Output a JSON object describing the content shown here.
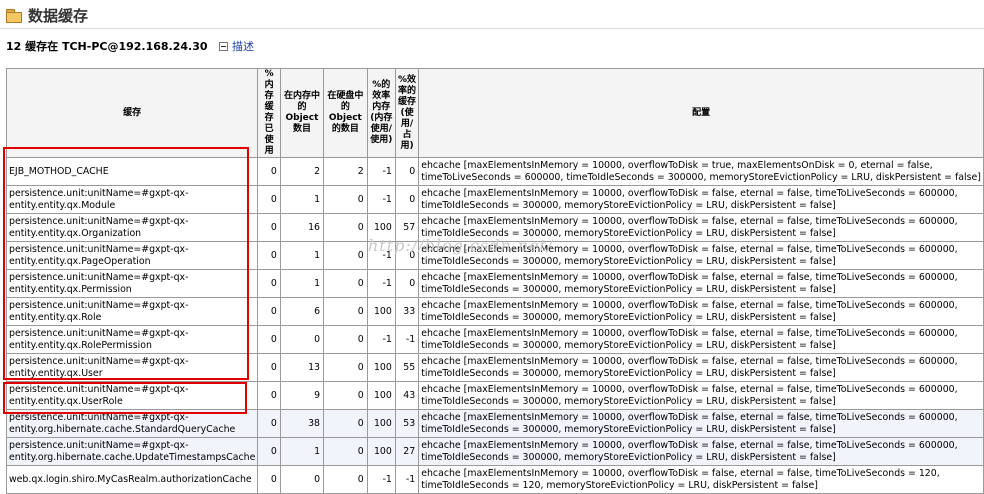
{
  "page": {
    "title": "数据缓存",
    "host_line": "12 缓存在 TCH-PC@192.168.24.30",
    "describe_link": "描述",
    "watermark": "http://blog.csdn.net/"
  },
  "table": {
    "headers": [
      "缓存",
      "%内存缓存已使用",
      "在内存中的Object数目",
      "在硬盘中的Object的数目",
      "%的效率内存(内存使用/使用)",
      "%效率的缓存(使用/占用)",
      "配置"
    ],
    "rows": [
      {
        "name": "EJB_MOTHOD_CACHE",
        "mem_used": "0",
        "in_mem": "2",
        "on_disk": "2",
        "mem_eff": "-1",
        "cache_eff": "0",
        "cfg1": "ehcache [maxElementsInMemory = 10000, overflowToDisk = true, maxElementsOnDisk = 0, eternal = false,",
        "cfg2": "timeToLiveSeconds = 600000, timeToIdleSeconds = 300000, memoryStoreEvictionPolicy = LRU, diskPersistent = false]"
      },
      {
        "name": "persistence.unit:unitName=#gxpt-qx-entity.entity.qx.Module",
        "mem_used": "0",
        "in_mem": "1",
        "on_disk": "0",
        "mem_eff": "-1",
        "cache_eff": "0",
        "cfg1": "ehcache [maxElementsInMemory = 10000, overflowToDisk = false, eternal = false, timeToLiveSeconds = 600000,",
        "cfg2": "timeToIdleSeconds = 300000, memoryStoreEvictionPolicy = LRU, diskPersistent = false]"
      },
      {
        "name": "persistence.unit:unitName=#gxpt-qx-entity.entity.qx.Organization",
        "mem_used": "0",
        "in_mem": "16",
        "on_disk": "0",
        "mem_eff": "100",
        "cache_eff": "57",
        "cfg1": "ehcache [maxElementsInMemory = 10000, overflowToDisk = false, eternal = false, timeToLiveSeconds = 600000,",
        "cfg2": "timeToIdleSeconds = 300000, memoryStoreEvictionPolicy = LRU, diskPersistent = false]"
      },
      {
        "name": "persistence.unit:unitName=#gxpt-qx-entity.entity.qx.PageOperation",
        "mem_used": "0",
        "in_mem": "1",
        "on_disk": "0",
        "mem_eff": "-1",
        "cache_eff": "0",
        "cfg1": "ehcache [maxElementsInMemory = 10000, overflowToDisk = false, eternal = false, timeToLiveSeconds = 600000,",
        "cfg2": "timeToIdleSeconds = 300000, memoryStoreEvictionPolicy = LRU, diskPersistent = false]"
      },
      {
        "name": "persistence.unit:unitName=#gxpt-qx-entity.entity.qx.Permission",
        "mem_used": "0",
        "in_mem": "1",
        "on_disk": "0",
        "mem_eff": "-1",
        "cache_eff": "0",
        "cfg1": "ehcache [maxElementsInMemory = 10000, overflowToDisk = false, eternal = false, timeToLiveSeconds = 600000,",
        "cfg2": "timeToIdleSeconds = 300000, memoryStoreEvictionPolicy = LRU, diskPersistent = false]"
      },
      {
        "name": "persistence.unit:unitName=#gxpt-qx-entity.entity.qx.Role",
        "mem_used": "0",
        "in_mem": "6",
        "on_disk": "0",
        "mem_eff": "100",
        "cache_eff": "33",
        "cfg1": "ehcache [maxElementsInMemory = 10000, overflowToDisk = false, eternal = false, timeToLiveSeconds = 600000,",
        "cfg2": "timeToIdleSeconds = 300000, memoryStoreEvictionPolicy = LRU, diskPersistent = false]"
      },
      {
        "name": "persistence.unit:unitName=#gxpt-qx-entity.entity.qx.RolePermission",
        "mem_used": "0",
        "in_mem": "0",
        "on_disk": "0",
        "mem_eff": "-1",
        "cache_eff": "-1",
        "cfg1": "ehcache [maxElementsInMemory = 10000, overflowToDisk = false, eternal = false, timeToLiveSeconds = 600000,",
        "cfg2": "timeToIdleSeconds = 300000, memoryStoreEvictionPolicy = LRU, diskPersistent = false]"
      },
      {
        "name": "persistence.unit:unitName=#gxpt-qx-entity.entity.qx.User",
        "mem_used": "0",
        "in_mem": "13",
        "on_disk": "0",
        "mem_eff": "100",
        "cache_eff": "55",
        "cfg1": "ehcache [maxElementsInMemory = 10000, overflowToDisk = false, eternal = false, timeToLiveSeconds = 600000,",
        "cfg2": "timeToIdleSeconds = 300000, memoryStoreEvictionPolicy = LRU, diskPersistent = false]"
      },
      {
        "name": "persistence.unit:unitName=#gxpt-qx-entity.entity.qx.UserRole",
        "mem_used": "0",
        "in_mem": "9",
        "on_disk": "0",
        "mem_eff": "100",
        "cache_eff": "43",
        "cfg1": "ehcache [maxElementsInMemory = 10000, overflowToDisk = false, eternal = false, timeToLiveSeconds = 600000,",
        "cfg2": "timeToIdleSeconds = 300000, memoryStoreEvictionPolicy = LRU, diskPersistent = false]"
      },
      {
        "name": "persistence.unit:unitName=#gxpt-qx-entity.org.hibernate.cache.StandardQueryCache",
        "mem_used": "0",
        "in_mem": "38",
        "on_disk": "0",
        "mem_eff": "100",
        "cache_eff": "53",
        "cfg1": "ehcache [maxElementsInMemory = 10000, overflowToDisk = false, eternal = false, timeToLiveSeconds = 600000,",
        "cfg2": "timeToIdleSeconds = 300000, memoryStoreEvictionPolicy = LRU, diskPersistent = false]"
      },
      {
        "name": "persistence.unit:unitName=#gxpt-qx-entity.org.hibernate.cache.UpdateTimestampsCache",
        "mem_used": "0",
        "in_mem": "1",
        "on_disk": "0",
        "mem_eff": "100",
        "cache_eff": "27",
        "cfg1": "ehcache [maxElementsInMemory = 10000, overflowToDisk = false, eternal = false, timeToLiveSeconds = 600000,",
        "cfg2": "timeToIdleSeconds = 300000, memoryStoreEvictionPolicy = LRU, diskPersistent = false]"
      },
      {
        "name": "web.qx.login.shiro.MyCasRealm.authorizationCache",
        "mem_used": "0",
        "in_mem": "0",
        "on_disk": "0",
        "mem_eff": "-1",
        "cache_eff": "-1",
        "cfg1": "ehcache [maxElementsInMemory = 10000, overflowToDisk = false, eternal = false, timeToLiveSeconds = 120,",
        "cfg2": "timeToIdleSeconds = 120, memoryStoreEvictionPolicy = LRU, diskPersistent = false]"
      }
    ]
  },
  "colors": {
    "highlight": "#e00000",
    "link": "#1a3fa6",
    "row_alt": "#f2f4fb"
  }
}
